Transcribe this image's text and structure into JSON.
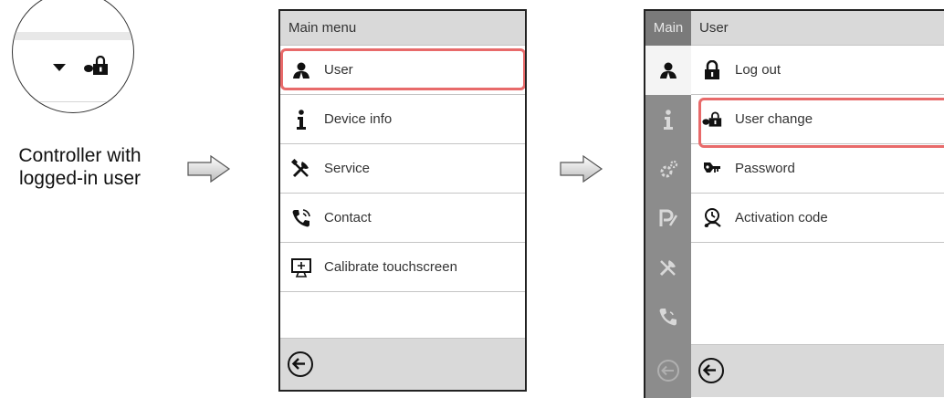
{
  "caption": {
    "line1": "Controller with",
    "line2": "logged-in user"
  },
  "main_menu": {
    "title": "Main menu",
    "items": [
      {
        "label": "User",
        "icon": "user-icon"
      },
      {
        "label": "Device info",
        "icon": "info-icon"
      },
      {
        "label": "Service",
        "icon": "tools-icon"
      },
      {
        "label": "Contact",
        "icon": "phone-icon"
      },
      {
        "label": "Calibrate touchscreen",
        "icon": "calibrate-icon"
      }
    ],
    "highlighted": "User"
  },
  "user_menu": {
    "rail_header": "Main",
    "title": "User",
    "items": [
      {
        "label": "Log out",
        "icon": "padlock-icon"
      },
      {
        "label": "User change",
        "icon": "user-change-icon"
      },
      {
        "label": "Password",
        "icon": "password-icon"
      },
      {
        "label": "Activation code",
        "icon": "activation-code-icon"
      }
    ],
    "highlighted": "User change",
    "rail_tabs": [
      "user-icon",
      "info-icon",
      "settings-icon",
      "program-icon",
      "tools-icon",
      "phone-icon"
    ]
  },
  "colors": {
    "highlight": "#e86a6a",
    "bar": "#d9d9d9",
    "rail": "#8c8c8c"
  }
}
